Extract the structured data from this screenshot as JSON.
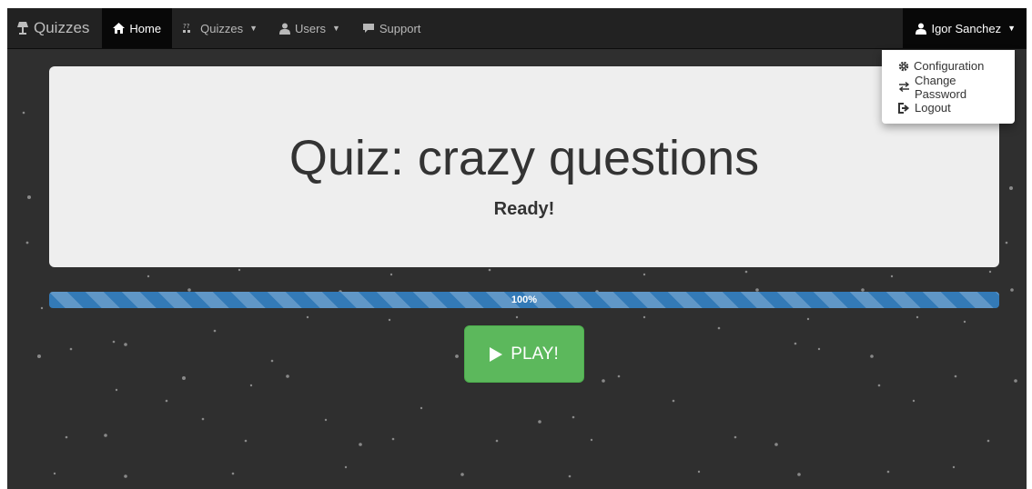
{
  "navbar": {
    "brand": "Quizzes",
    "items": [
      {
        "label": "Home",
        "icon": "home-icon",
        "active": true
      },
      {
        "label": "Quizzes",
        "icon": "quizzes-icon",
        "dropdown": true
      },
      {
        "label": "Users",
        "icon": "user-icon",
        "dropdown": true
      },
      {
        "label": "Support",
        "icon": "comment-icon"
      }
    ],
    "user": {
      "name": "Igor Sanchez",
      "icon": "user-icon"
    }
  },
  "user_menu": {
    "items": [
      {
        "label": "Configuration",
        "icon": "gear-icon"
      },
      {
        "label": "Change Password",
        "icon": "transfer-icon"
      },
      {
        "label": "Logout",
        "icon": "logout-icon"
      }
    ]
  },
  "jumbotron": {
    "title": "Quiz: crazy questions",
    "status": "Ready!"
  },
  "progress": {
    "value": 100,
    "label": "100%"
  },
  "play_button": {
    "label": "PLAY!",
    "icon": "play-icon"
  },
  "colors": {
    "page_bg": "#2f2f2f",
    "navbar_bg": "#222222",
    "progress_bar": "#337ab7",
    "play_button": "#5cb85c"
  }
}
